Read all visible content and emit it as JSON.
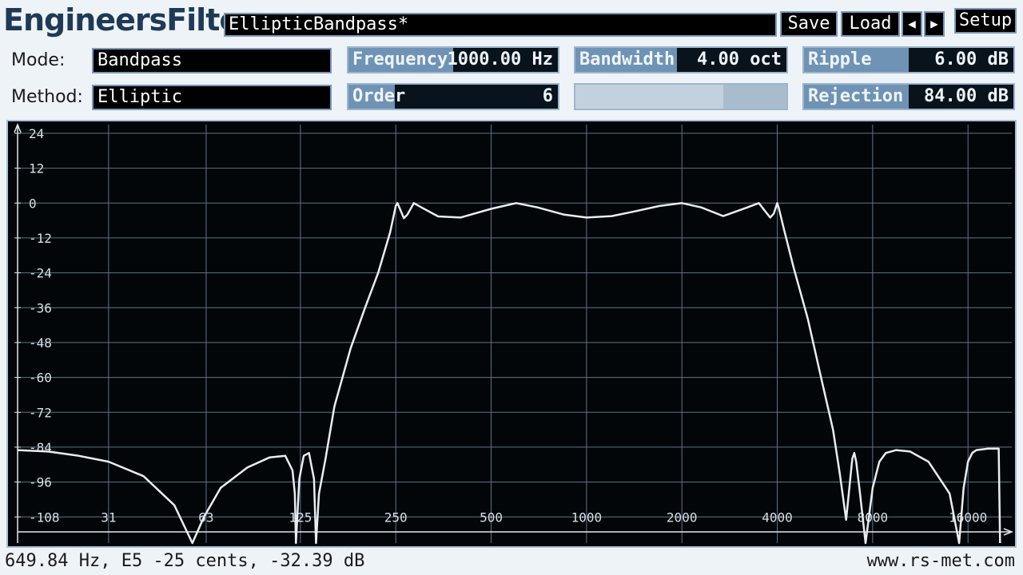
{
  "app": {
    "title": "EngineersFilter"
  },
  "preset": {
    "name": "EllipticBandpass*"
  },
  "toolbar": {
    "save": "Save",
    "load": "Load",
    "prev": "◀",
    "next": "▶",
    "setup": "Setup"
  },
  "mode": {
    "label": "Mode:",
    "value": "Bandpass"
  },
  "method": {
    "label": "Method:",
    "value": "Elliptic"
  },
  "params": {
    "frequency": {
      "label": "Frequency",
      "value": "1000.00 Hz",
      "level": 0.5
    },
    "order": {
      "label": "Order",
      "value": "6",
      "level": 0.22
    },
    "bandwidth": {
      "label": "Bandwidth",
      "value": "4.00 oct",
      "level": 0.48
    },
    "ripple": {
      "label": "Ripple",
      "value": "6.00 dB",
      "level": 0.5
    },
    "rejection": {
      "label": "Rejection",
      "value": "84.00 dB",
      "level": 0.5
    },
    "blank": {
      "level": 0.7
    }
  },
  "status": {
    "readout": "649.84 Hz, E5 -25 cents, -32.39 dB",
    "url": "www.rs-met.com"
  },
  "colors": {
    "curve": "#e8edf2",
    "grid": "#5e7488",
    "plot_bg": "#030608",
    "slider_fill": "#6f93b4"
  },
  "chart_data": {
    "type": "line",
    "xscale": "log",
    "xlim": [
      16,
      22000
    ],
    "ylim": [
      -117,
      27
    ],
    "x_ticks": [
      31,
      63,
      125,
      250,
      500,
      1000,
      2000,
      4000,
      8000,
      16000
    ],
    "x_tick_labels": [
      "31",
      "63",
      "125",
      "250",
      "500",
      "1000",
      "2000",
      "4000",
      "8000",
      "16000"
    ],
    "y_ticks": [
      24,
      12,
      0,
      -12,
      -24,
      -36,
      -48,
      -60,
      -72,
      -84,
      -96,
      -108
    ],
    "y_tick_labels": [
      "24",
      "12",
      "0",
      "-12",
      "-24",
      "-36",
      "-48",
      "-60",
      "-72",
      "-84",
      "-96",
      "-108"
    ],
    "series": [
      {
        "x": [
          16,
          20,
          25,
          31,
          40,
          50,
          57,
          62,
          70,
          85,
          100,
          112,
          118,
          120,
          121,
          124,
          128,
          133,
          138,
          140,
          143,
          150,
          160,
          180,
          200,
          220,
          240,
          250,
          253,
          260,
          265,
          272,
          285,
          300,
          340,
          400,
          500,
          600,
          700,
          850,
          1000,
          1200,
          1400,
          1700,
          2000,
          2300,
          2700,
          3200,
          3500,
          3700,
          3800,
          3900,
          4000,
          4050,
          4200,
          4500,
          5000,
          5500,
          6000,
          6300,
          6600,
          6900,
          7000,
          7100,
          7300,
          7600,
          8000,
          8400,
          8800,
          9500,
          10500,
          12000,
          14000,
          15000,
          15500,
          16000,
          16500,
          17000,
          18500,
          20000,
          20200
        ],
        "y": [
          -85,
          -85.5,
          -87,
          -89,
          -94,
          -104,
          -117,
          -108,
          -98,
          -91,
          -87.5,
          -87,
          -92,
          -100,
          -117,
          -95,
          -87,
          -86,
          -95,
          -117,
          -100,
          -88,
          -70,
          -50,
          -36,
          -24,
          -10,
          -1,
          0,
          -3,
          -5.2,
          -4,
          0,
          -1.4,
          -4.6,
          -5,
          -2,
          0,
          -1.5,
          -4,
          -5,
          -4.5,
          -3,
          -1,
          0,
          -1.5,
          -4.5,
          -1.6,
          0,
          -3.4,
          -5,
          -3.6,
          0,
          -2,
          -9,
          -22,
          -40,
          -60,
          -78,
          -93,
          -109,
          -88,
          -86,
          -89,
          -100,
          -117,
          -98,
          -89,
          -86,
          -85,
          -85.5,
          -89,
          -100,
          -117,
          -98,
          -89,
          -86,
          -85,
          -84.5,
          -84.5,
          -117
        ]
      }
    ]
  }
}
